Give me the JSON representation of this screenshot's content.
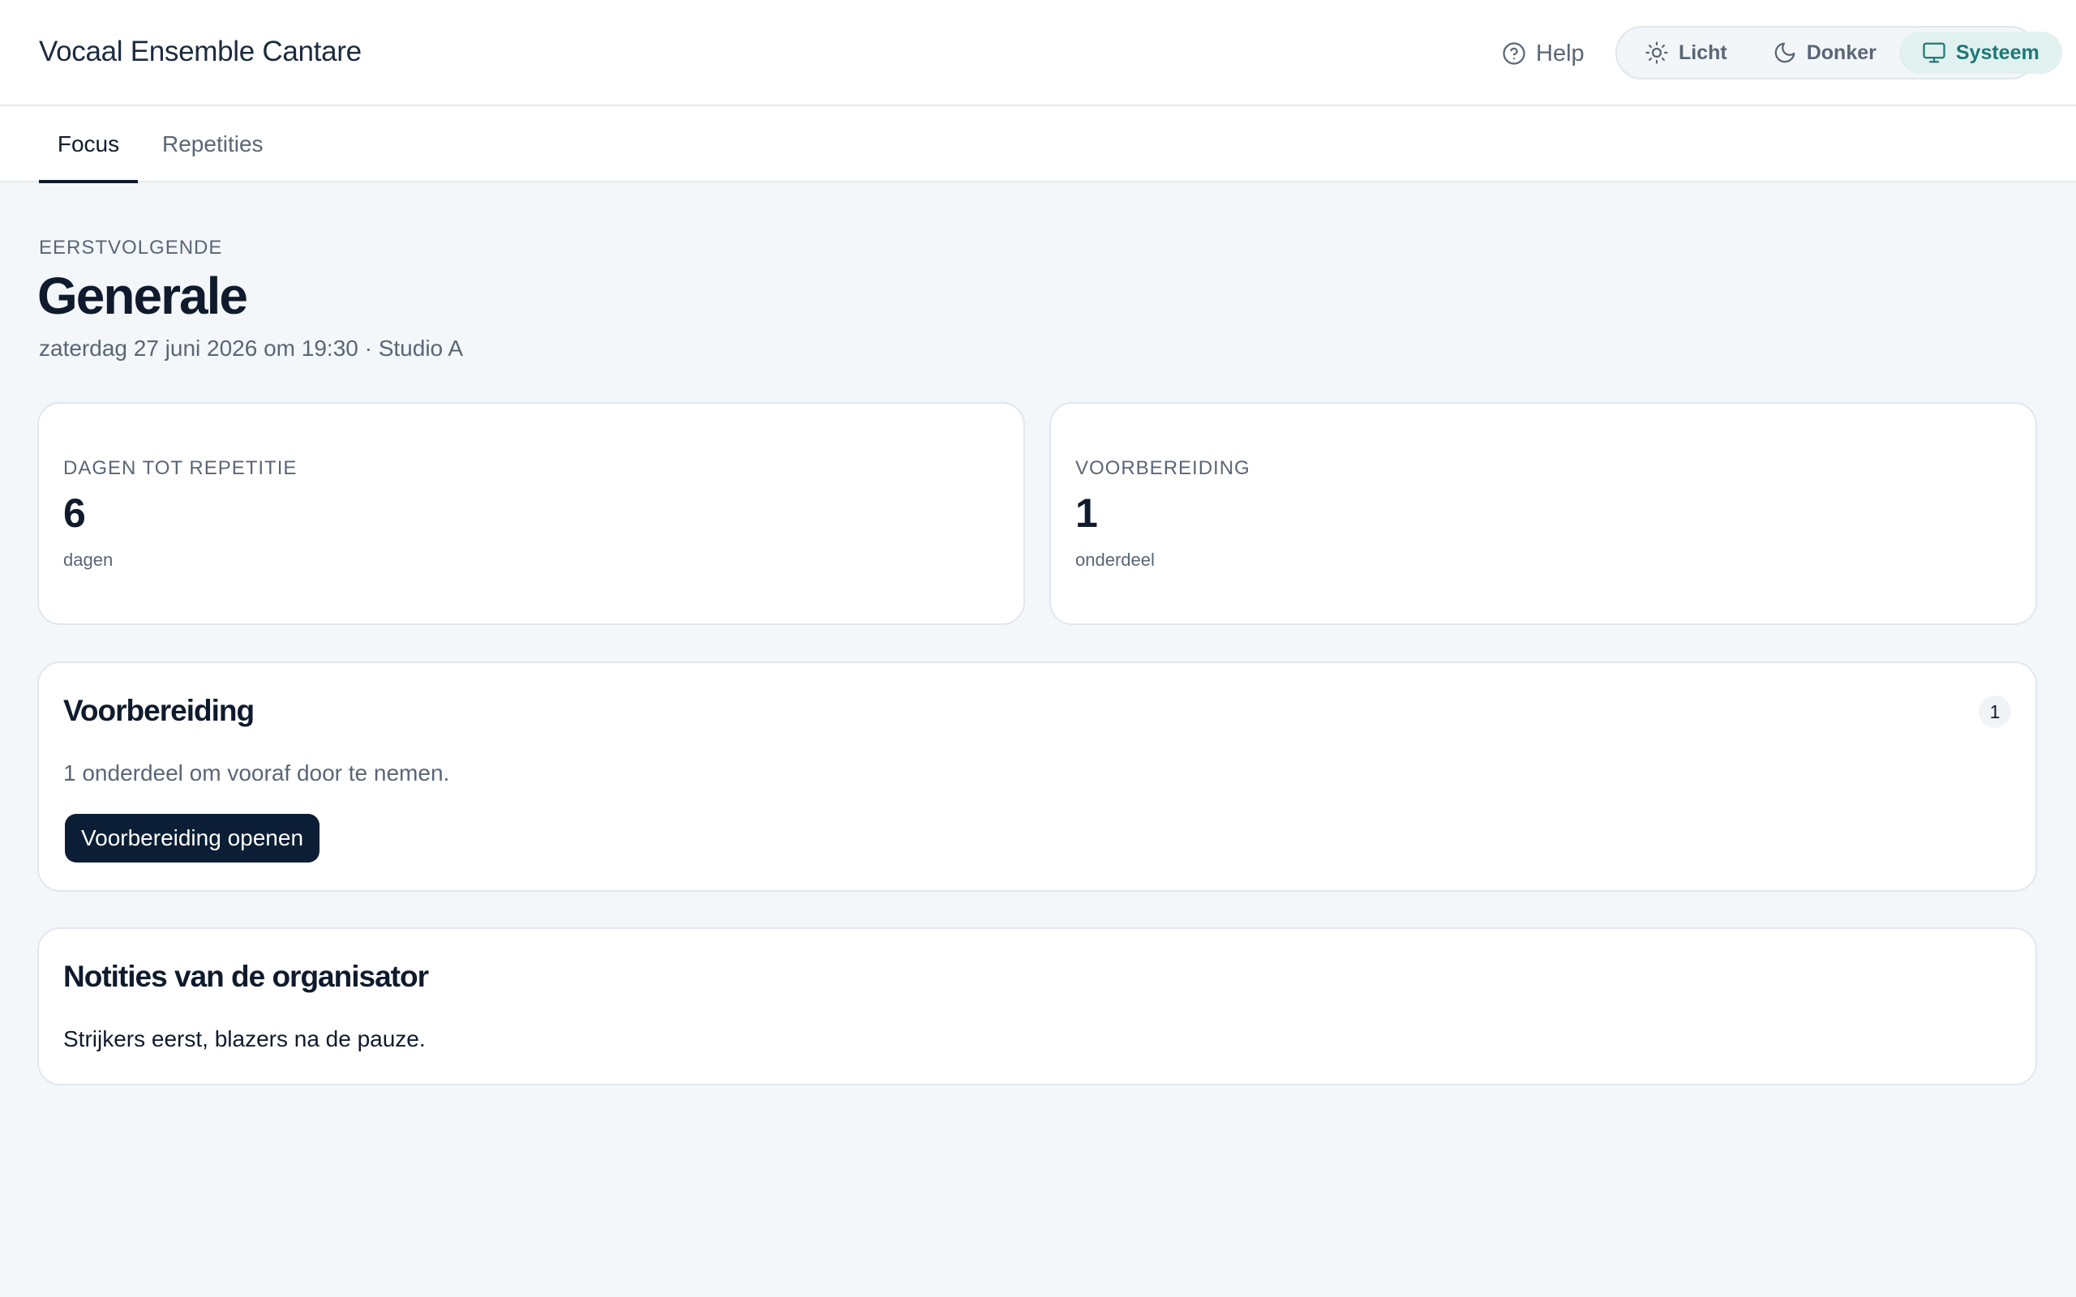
{
  "header": {
    "app_title": "Vocaal Ensemble Cantare",
    "help_label": "Help",
    "theme_options": [
      {
        "label": "Licht",
        "icon": "sun-icon"
      },
      {
        "label": "Donker",
        "icon": "moon-icon"
      },
      {
        "label": "Systeem",
        "icon": "monitor-icon",
        "active": true
      }
    ]
  },
  "tabs": [
    {
      "label": "Focus",
      "active": true
    },
    {
      "label": "Repetities",
      "active": false
    }
  ],
  "next": {
    "eyebrow": "EERSTVOLGENDE",
    "title": "Generale",
    "subtitle": "zaterdag 27 juni 2026 om 19:30 · Studio A"
  },
  "stats": [
    {
      "label": "DAGEN TOT REPETITIE",
      "value": "6",
      "unit": "dagen"
    },
    {
      "label": "VOORBEREIDING",
      "value": "1",
      "unit": "onderdeel"
    }
  ],
  "preparation": {
    "title": "Voorbereiding",
    "count": "1",
    "text": "1 onderdeel om vooraf door te nemen.",
    "button_label": "Voorbereiding openen"
  },
  "notes": {
    "title": "Notities van de organisator",
    "text": "Strijkers eerst, blazers na de pauze."
  },
  "colors": {
    "accent": "#1c7876",
    "primary": "#0b1e35",
    "background": "#f4f7fa"
  }
}
